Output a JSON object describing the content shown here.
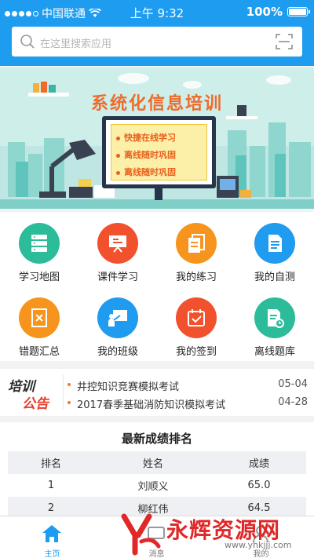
{
  "status_bar": {
    "carrier": "中国联通",
    "time": "上午 9:32",
    "battery": "100%"
  },
  "search": {
    "placeholder": "在这里搜索应用"
  },
  "banner": {
    "title": "系统化信息培训",
    "points": [
      "快捷在线学习",
      "离线随时巩固",
      "离线随时巩固"
    ]
  },
  "grid": {
    "items": [
      {
        "label": "学习地图",
        "icon": "stack-icon",
        "color": "#2cbc9a"
      },
      {
        "label": "课件学习",
        "icon": "presentation-icon",
        "color": "#f2512d"
      },
      {
        "label": "我的练习",
        "icon": "documents-icon",
        "color": "#f7941d"
      },
      {
        "label": "我的自测",
        "icon": "document-icon",
        "color": "#1f9bef"
      },
      {
        "label": "错题汇总",
        "icon": "wrong-book-icon",
        "color": "#f7941d"
      },
      {
        "label": "我的班级",
        "icon": "classroom-icon",
        "color": "#1f9bef"
      },
      {
        "label": "我的签到",
        "icon": "calendar-check-icon",
        "color": "#f2512d"
      },
      {
        "label": "离线题库",
        "icon": "offline-doc-icon",
        "color": "#2cbc9a"
      }
    ]
  },
  "notice": {
    "badge_top": "培训",
    "badge_bottom": "公告",
    "items": [
      {
        "title": "井控知识竞赛模拟考试",
        "date": "05-04"
      },
      {
        "title": "2017春季基础消防知识模拟考试",
        "date": "04-28"
      }
    ]
  },
  "ranking": {
    "title": "最新成绩排名",
    "columns": [
      "排名",
      "姓名",
      "成绩"
    ],
    "rows": [
      [
        "1",
        "刘顺义",
        "65.0"
      ],
      [
        "2",
        "柳红伟",
        "64.5"
      ]
    ]
  },
  "tabbar": {
    "items": [
      {
        "label": "主页",
        "icon": "home-icon",
        "active": true
      },
      {
        "label": "消息",
        "icon": "message-icon",
        "active": false
      },
      {
        "label": "我的",
        "icon": "profile-icon",
        "active": false
      }
    ]
  },
  "watermark": {
    "text": "永辉资源网",
    "url": "www.yhkjjj.com"
  },
  "colors": {
    "primary": "#1e9cf0",
    "orange": "#f06a2b"
  }
}
